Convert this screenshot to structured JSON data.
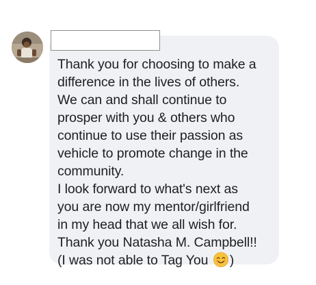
{
  "comment": {
    "author_name": "",
    "lines": [
      "Thank you for choosing to make a",
      "difference in the lives of others.",
      "We can and shall continue to",
      "prosper with you & others who",
      "continue to use their passion as",
      "vehicle to promote change in the",
      "community.",
      "I look forward to what's next as",
      "you are now my mentor/girlfriend",
      "in my head that we all wish for.",
      "Thank you Natasha M. Campbell!!"
    ],
    "last_line_prefix": "(I was not able to Tag You ",
    "last_line_suffix": ")",
    "emoji": "smiling-face-icon"
  },
  "colors": {
    "bubble": "#f0f1f4",
    "text": "#1c1e21",
    "name_box_border": "#8e8e8e"
  }
}
